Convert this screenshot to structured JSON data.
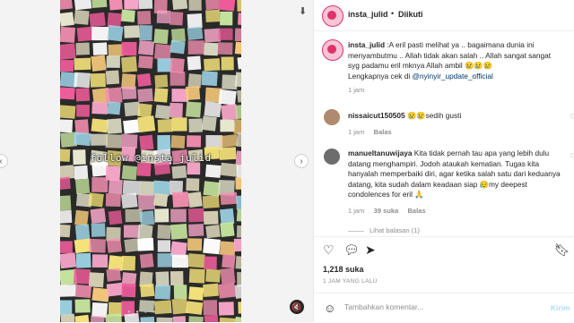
{
  "media": {
    "watermark": "follow @insta_julid",
    "carousel_dots": "● ● ● ● ● ●"
  },
  "header": {
    "username": "insta_julid",
    "dot": "•",
    "follow_status": "Diikuti"
  },
  "caption": {
    "username": "insta_julid",
    "text": ":A eril pasti melihat ya .. bagaimana dunia ini menyambutmu .. Allah tidak akan salah .. Allah sangat sangat syg padamu eril mknya Allah ambil 😢😢😢",
    "line2_prefix": "Lengkapnya cek di ",
    "mention": "@nyinyir_update_official",
    "time": "1 jam"
  },
  "comments": [
    {
      "username": "nissaicut150505",
      "text": "😢😢sedih gusti",
      "time": "1 jam",
      "reply_label": "Balas"
    },
    {
      "username": "manueltanuwijaya",
      "text": "Kita tidak pernah tau apa yang lebih dulu datang menghampiri. Jodoh ataukah kematian. Tugas kita hanyalah memperbaiki diri, agar ketika salah satu dari keduanya datang, kita sudah dalam keadaan siap 😥my deepest condolences for eril 🙏",
      "time": "1 jam",
      "likes": "39 suka",
      "reply_label": "Balas",
      "view_replies": "Lihat balasan (1)"
    }
  ],
  "actions": {
    "like_icon": "heart-icon",
    "comment_icon": "comment-icon",
    "share_icon": "share-icon",
    "save_icon": "bookmark-icon"
  },
  "likes_count": "1,218 suka",
  "post_time": "1 JAM YANG LALU",
  "add_comment": {
    "placeholder": "Tambahkan komentar...",
    "post_label": "Kirim"
  },
  "colors": {
    "accent_pink": "#e1306c",
    "link_blue": "#00376b",
    "muted_gray": "#8e8e8e",
    "post_button_disabled": "#b3dbff"
  }
}
